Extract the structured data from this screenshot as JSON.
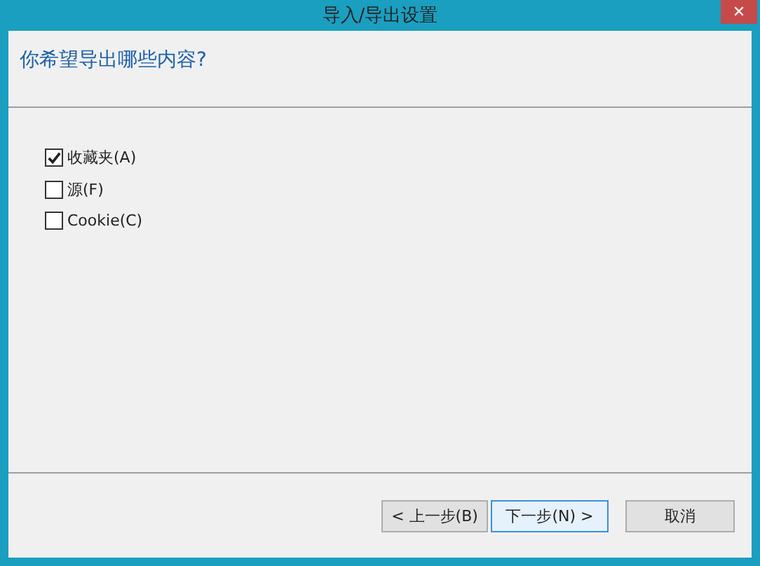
{
  "window": {
    "title": "导入/导出设置",
    "close": "✕"
  },
  "heading": "你希望导出哪些内容?",
  "options": [
    {
      "label": "收藏夹(A)",
      "checked": true
    },
    {
      "label": "源(F)",
      "checked": false
    },
    {
      "label": "Cookie(C)",
      "checked": false
    }
  ],
  "buttons": [
    {
      "label": "< 上一步(B)",
      "selected": false
    },
    {
      "label": "下一步(N) >",
      "selected": true
    },
    {
      "label": "取消",
      "selected": false
    }
  ]
}
